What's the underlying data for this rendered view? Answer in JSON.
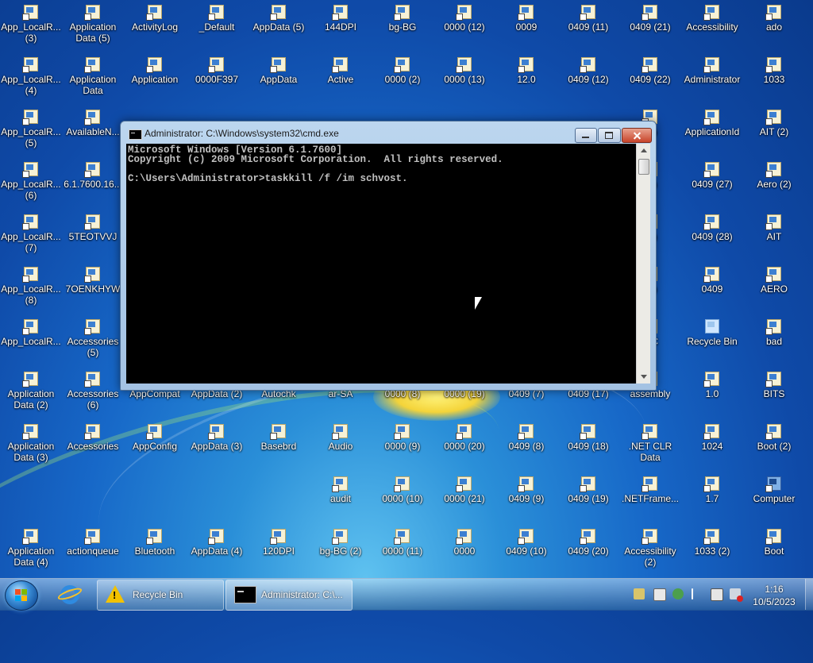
{
  "desktop_icons": {
    "c0": [
      "App_LocalR...\n(3)",
      "App_LocalR...\n(4)",
      "App_LocalR...\n(5)",
      "App_LocalR...\n(6)",
      "App_LocalR...\n(7)",
      "App_LocalR...\n(8)",
      "App_LocalR...",
      "Application\nData (2)",
      "Application\nData (3)",
      "",
      "Application\nData (4)"
    ],
    "c1": [
      "Application\nData (5)",
      "Application\nData",
      "AvailableN...",
      "6.1.7600.16...",
      "5TEOTVVJ",
      "7OENKHYW",
      "Accessories\n(5)",
      "Accessories\n(6)",
      "Accessories",
      "",
      "actionqueue"
    ],
    "c2": [
      "ActivityLog",
      "Application",
      "",
      "",
      "",
      "",
      "",
      "AppCompat",
      "AppConfig",
      "",
      "Bluetooth"
    ],
    "c3": [
      "_Default",
      "0000F397",
      "",
      "",
      "",
      "",
      "",
      "AppData (2)",
      "AppData (3)",
      "",
      "AppData (4)"
    ],
    "c4": [
      "AppData (5)",
      "AppData",
      "",
      "",
      "",
      "",
      "",
      "Autochk",
      "Basebrd",
      "",
      "120DPI"
    ],
    "c5": [
      "144DPI",
      "Active",
      "",
      "",
      "",
      "",
      "",
      "ar-SA",
      "Audio",
      "audit",
      "bg-BG (2)"
    ],
    "c6": [
      "bg-BG",
      "0000 (2)",
      "",
      "",
      "",
      "",
      "",
      "0000 (8)",
      "0000 (9)",
      "0000 (10)",
      "0000 (11)"
    ],
    "c7": [
      "0000 (12)",
      "0000 (13)",
      "",
      "",
      "",
      "",
      "",
      "0000 (19)",
      "0000 (20)",
      "0000 (21)",
      "0000"
    ],
    "c8": [
      "0009",
      "12.0",
      "",
      "",
      "",
      "",
      "",
      "0409 (7)",
      "0409 (8)",
      "0409 (9)",
      "0409 (10)"
    ],
    "c9": [
      "0409 (11)",
      "0409 (12)",
      "",
      "",
      "",
      "",
      "",
      "0409 (17)",
      "0409 (18)",
      "0409 (19)",
      "0409 (20)"
    ],
    "c10": [
      "0409 (21)",
      "0409 (22)",
      "23)",
      "24)",
      "25)",
      "26)",
      "IXC",
      "assembly",
      ".NET CLR\nData",
      ".NETFrame...",
      "Accessibility\n(2)"
    ],
    "c11": [
      "Accessibility",
      "Administrator",
      "ApplicationId",
      "0409 (27)",
      "0409 (28)",
      "0409",
      "Recycle Bin",
      "1.0",
      "1024",
      "1.7",
      "1033 (2)"
    ],
    "c12": [
      "ado",
      "1033",
      "AIT (2)",
      "Aero (2)",
      "AIT",
      "AERO",
      "bad",
      "BITS",
      "Boot (2)",
      "Computer",
      "Boot"
    ]
  },
  "cmd_window": {
    "title": "Administrator: C:\\Windows\\system32\\cmd.exe",
    "line1": "Microsoft Windows [Version 6.1.7600]",
    "line2": "Copyright (c) 2009 Microsoft Corporation.  All rights reserved.",
    "line4": "C:\\Users\\Administrator>taskkill /f /im schvost."
  },
  "taskbar": {
    "recycle_label": "Recycle Bin",
    "cmd_label": "Administrator: C:\\..."
  },
  "clock": {
    "time": "1:16",
    "date": "10/5/2023"
  }
}
